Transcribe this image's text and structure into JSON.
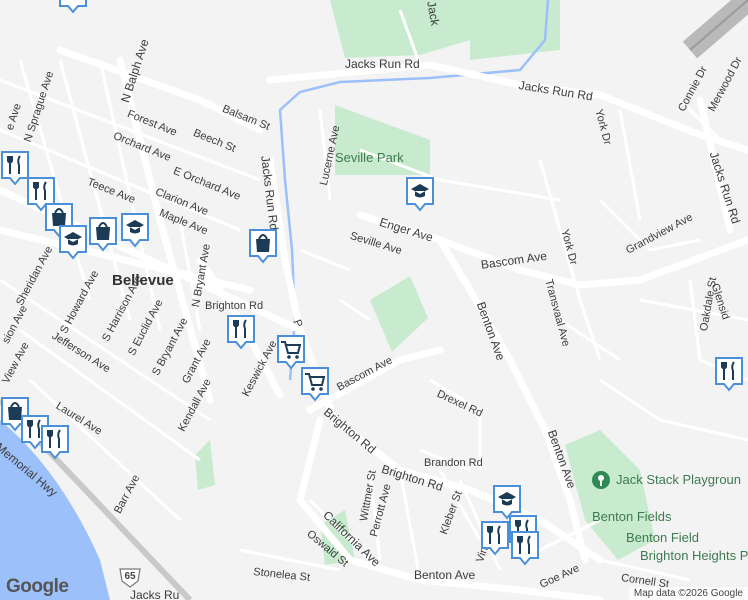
{
  "map": {
    "brand": "Google",
    "attribution": "Map data ©2026 Google",
    "colors": {
      "background": "#f3f3f3",
      "road": "#ffffff",
      "road_outline": "#d6d6d6",
      "park": "#c8ebcf",
      "water": "#9cc0f9",
      "highway": "#b9b9b9",
      "marker": "#4a90d9"
    },
    "highway_shield": "65",
    "labels": {
      "jacks_run_rd_top": "Jacks Run Rd",
      "jacks_run_rd_top2": "Jacks Run Rd",
      "jacks_run_rd_left": "Jacks Run Rd",
      "jacks_run_rd_right": "Jacks Run Rd",
      "jacks_run_rd_bottom": "Jacks Ru",
      "jacks_top_clip": "Jack",
      "seville_park": "Seville Park",
      "enger_ave": "Enger Ave",
      "seville_ave": "Seville Ave",
      "bascom_ave_right": "Bascom Ave",
      "bascom_ave_left": "Bascom Ave",
      "benton_ave_1": "Benton Ave",
      "benton_ave_2": "Benton Ave",
      "benton_ave_bottom": "Benton Ave",
      "brighton_rd_1": "Brighton Rd",
      "brighton_rd_2": "Brighton Rd",
      "brighton_rd_3": "Brighton Rd",
      "brighton_rd_short": "Brighton Rd",
      "brighton_heights_park": "Brighton Heights Park",
      "benton_fields": "Benton Fields",
      "benton_field": "Benton Field",
      "jack_stack": "Jack Stack Playgroun",
      "bellevue": "Bellevue",
      "n_balph_ave": "N Balph Ave",
      "forest_ave": "Forest Ave",
      "orchard_ave": "Orchard Ave",
      "e_orchard_ave": "E Orchard Ave",
      "beech_st": "Beech St",
      "balsam_st": "Balsam St",
      "clarion_ave": "Clarion Ave",
      "maple_ave": "Maple Ave",
      "teece_ave": "Teece Ave",
      "lucerne_ave": "Lucerne Ave",
      "n_sprague_ave": "N Sprague Ave",
      "sheridan_ave": "Sheridan Ave",
      "s_howard_ave": "S Howard Ave",
      "s_harrison_ave": "S Harrison Ave",
      "s_euclid_ave": "S Euclid Ave",
      "s_bryant_ave": "S Bryant Ave",
      "n_bryant_ave": "N Bryant Ave",
      "grant_ave": "Grant Ave",
      "jefferson_ave": "Jefferson Ave",
      "kendall_ave": "Kendall Ave",
      "keswick_ave": "Keswick Ave",
      "laurel_ave": "Laurel Ave",
      "memorial_hwy": "Memorial Hwy",
      "barr_ave": "Barr Ave",
      "view_ave": "View Ave",
      "sion_ave": "sion Ave",
      "e_ave": "e Ave",
      "connie_dr": "Connie Dr",
      "merwood_dr": "Merwood Dr",
      "york_dr_1": "York Dr",
      "york_dr_2": "York Dr",
      "grandview_ave": "Grandview Ave",
      "transvaal_ave": "Transvaal Ave",
      "oakdale_st": "Oakdale St",
      "glenside": "Glensid",
      "drexel_rd": "Drexel Rd",
      "brandon_rd": "Brandon Rd",
      "kleber_st": "Kleber St",
      "vinth_st": "Vinth St",
      "wittmer_st": "Wittmer St",
      "perrott_ave": "Perrott Ave",
      "california_ave": "California Ave",
      "oswald_st": "Oswald St",
      "stonelea_st": "Stonelea St",
      "goe_ave": "Goe Ave",
      "cornell_st": "Cornell St",
      "bascom_short": "Bascom Ave",
      "p_clip": "P"
    },
    "pins": [
      {
        "name": "school-pin-enger",
        "icon": "school-icon"
      },
      {
        "name": "shopping-pin-jacks",
        "icon": "shopping-bag-icon"
      },
      {
        "name": "restaurant-pin-brighton",
        "icon": "restaurant-icon"
      },
      {
        "name": "grocery-pin-1",
        "icon": "grocery-cart-icon"
      },
      {
        "name": "grocery-pin-2",
        "icon": "grocery-cart-icon"
      },
      {
        "name": "school-pin-bottom",
        "icon": "school-icon"
      },
      {
        "name": "restaurant-pin-bottom-1",
        "icon": "restaurant-icon"
      },
      {
        "name": "restaurant-pin-bottom-2",
        "icon": "restaurant-icon"
      },
      {
        "name": "restaurant-pin-bottom-3",
        "icon": "restaurant-icon"
      },
      {
        "name": "restaurant-pin-right",
        "icon": "restaurant-icon"
      },
      {
        "name": "school-pin-bellevue-1",
        "icon": "school-icon"
      },
      {
        "name": "shopping-pin-bellevue",
        "icon": "shopping-bag-icon"
      },
      {
        "name": "school-pin-bellevue-2",
        "icon": "school-icon"
      },
      {
        "name": "restaurant-pin-bellevue-1",
        "icon": "restaurant-icon"
      },
      {
        "name": "restaurant-pin-bellevue-2",
        "icon": "restaurant-icon"
      },
      {
        "name": "restaurant-pin-left-1",
        "icon": "restaurant-icon"
      },
      {
        "name": "restaurant-pin-left-2",
        "icon": "restaurant-icon"
      },
      {
        "name": "shopping-pin-left",
        "icon": "shopping-bag-icon"
      },
      {
        "name": "playground-pin",
        "icon": "playground-icon"
      }
    ]
  }
}
